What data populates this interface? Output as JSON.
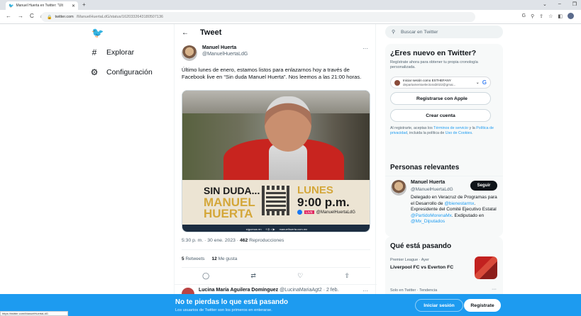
{
  "browser": {
    "tab_title": "Manuel Huerta en Twitter: \"Últ",
    "url_host": "twitter.com",
    "url_path": "/ManuelHuertaLdG/status/1620332643180507136",
    "status_url": "https://twitter.com/ManuelHuertaLdG"
  },
  "leftnav": {
    "explore": "Explorar",
    "settings": "Configuración"
  },
  "header": {
    "title": "Tweet"
  },
  "tweet": {
    "name": "Manuel Huerta",
    "handle": "@ManuelHuertaLdG",
    "text": "Último lunes de enero, estamos listos para enlazarnos hoy a través de Facebook live en “Sin duda Manuel Huerta”. Nos leemos a las 21:00 horas.",
    "timestamp": "5:30 p. m. · 30 ene. 2023 ·",
    "views": "462",
    "views_label": "Reproducciones",
    "retweets": "5",
    "retweets_label": "Retweets",
    "likes": "12",
    "likes_label": "Me gusta"
  },
  "media": {
    "line1": "SIN DUDA...",
    "line2": "MANUEL",
    "line3": "HUERTA",
    "day": "LUNES",
    "time": "9:00 p.m.",
    "live": "LIVE",
    "fb_handle": "@ManuelHuertaLdG",
    "footer_left": "síguenos en",
    "footer_right": "manuelhuerta.com.mx"
  },
  "reply": {
    "name": "Lucina María Aguilera Domínguez",
    "handle": "@LucinaMariaAgt2 · 2 feb."
  },
  "sidebar": {
    "search_placeholder": "Buscar en Twitter",
    "new_title": "¿Eres nuevo en Twitter?",
    "new_sub": "Regístrate ahora para obtener tu propia cronología personalizada.",
    "google_line1": "Iniciar sesión como ESTHEFANY",
    "google_line2": "departamentoelectoral2022@gmai...",
    "apple": "Registrarse con Apple",
    "create": "Crear cuenta",
    "terms_a": "Al registrarte, aceptas los ",
    "terms_link1": "Términos de servicio",
    "terms_b": " y la ",
    "terms_link2": "Política de privacidad",
    "terms_c": ", incluida la política de ",
    "terms_link3": "Uso de Cookies",
    "terms_d": ".",
    "relevant_title": "Personas relevantes",
    "person_name": "Manuel Huerta",
    "person_handle": "@ManuelHuertaLdG",
    "follow": "Seguir",
    "bio_a": "Delegado en Veracruz de Programas para el Desarrollo de ",
    "bio_link1": "@bienestarmx",
    "bio_b": ". Expresidente del Comité Ejecutivo Estatal ",
    "bio_link2": "@PartidoMorenaMx",
    "bio_c": ". Exdiputado en ",
    "bio_link3": "@Mx_Diputados",
    "trending_title": "Qué está pasando",
    "trend_meta": "Premier League · Ayer",
    "trend_title": "Liverpool FC vs Everton FC",
    "trend2_meta": "Solo en Twitter · Tendencia"
  },
  "bottom": {
    "title": "No te pierdas lo que está pasando",
    "sub": "Los usuarios de Twitter son los primeros en enterarse.",
    "login": "Iniciar sesión",
    "signup": "Regístrate"
  },
  "colors": {
    "accent": "#1d9bf0",
    "text": "#0f1419",
    "muted": "#536471"
  }
}
